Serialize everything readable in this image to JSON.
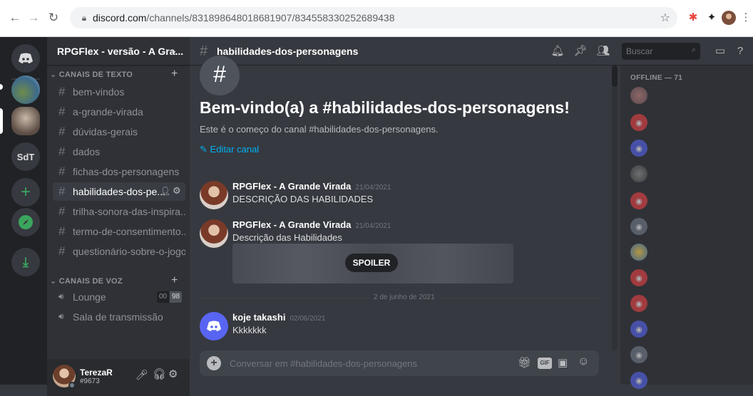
{
  "browser": {
    "url_host": "discord.com",
    "url_path": "/channels/831898648018681907/834558330252689438"
  },
  "rail": {
    "initials_server": "SdT"
  },
  "guild": {
    "name": "RPGFlex - versão - A Gra...",
    "text_category": "CANAIS DE TEXTO",
    "voice_category": "CANAIS DE VOZ",
    "text_channels": [
      "bem-vindos",
      "a-grande-virada",
      "dúvidas-gerais",
      "dados",
      "fichas-dos-personagens",
      "habilidades-dos-pe...",
      "trilha-sonora-das-inspira...",
      "termo-de-consentimento...",
      "questionário-sobre-o-jogo"
    ],
    "voice_channels": [
      {
        "name": "Lounge",
        "count_left": "00",
        "count_right": "98"
      },
      {
        "name": "Sala de transmissão"
      }
    ]
  },
  "user": {
    "name": "TerezaR",
    "tag": "#9673"
  },
  "channel": {
    "name": "habilidades-dos-personagens",
    "search_placeholder": "Buscar",
    "welcome_title": "Bem-vindo(a) a #habilidades-dos-personagens!",
    "welcome_sub": "Este é o começo do canal #habilidades-dos-personagens.",
    "edit_label": "Editar canal",
    "composer_placeholder": "Conversar em #habilidades-dos-personagens"
  },
  "messages": [
    {
      "author": "RPGFlex - A Grande Virada",
      "date": "21/04/2021",
      "text": "DESCRIÇÃO DAS HABILIDADES"
    },
    {
      "author": "RPGFlex - A Grande Virada",
      "date": "21/04/2021",
      "text": "Descrição das Habilidades",
      "spoiler_label": "SPOILER"
    },
    {
      "author": "koje takashi",
      "date": "02/06/2021",
      "text": "Kkkkkkk"
    }
  ],
  "date_divider": "2 de junho de 2021",
  "members": {
    "offline_header": "OFFLINE — 71"
  },
  "colors": {
    "blurple": "#5865f2",
    "red_avatar": "#ed4245",
    "grey_avatar": "#747f8d",
    "green": "#3ba55d",
    "link": "#00b0f4"
  }
}
